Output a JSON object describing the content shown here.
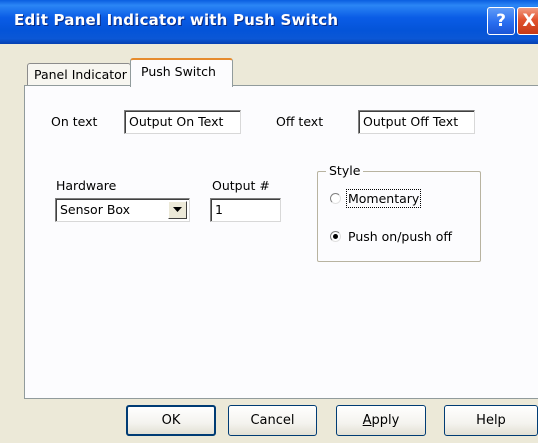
{
  "window": {
    "title": "Edit Panel Indicator with Push Switch",
    "help_button": "?",
    "close_button": "X"
  },
  "tabs": [
    {
      "label": "Panel Indicator",
      "active": false
    },
    {
      "label": "Push Switch",
      "active": true
    }
  ],
  "on_text": {
    "label": "On text",
    "value": "Output On Text"
  },
  "off_text": {
    "label": "Off text",
    "value": "Off text",
    "field_value": "Output Off Text"
  },
  "hardware": {
    "label": "Hardware",
    "selected": "Sensor Box"
  },
  "output": {
    "label": "Output #",
    "value": "1"
  },
  "style": {
    "label": "Style",
    "options": [
      {
        "label": "Momentary",
        "selected": false
      },
      {
        "label": "Push on/push off",
        "selected": true
      }
    ]
  },
  "buttons": {
    "ok": "OK",
    "cancel": "Cancel",
    "apply": "Apply",
    "help": "Help"
  },
  "colors": {
    "titlebar": "#0a5ce6",
    "dialog_bg": "#ece9d8",
    "panel_bg": "#fcfcfe",
    "active_tab_accent": "#e68b2c",
    "close_button": "#e2532e"
  }
}
